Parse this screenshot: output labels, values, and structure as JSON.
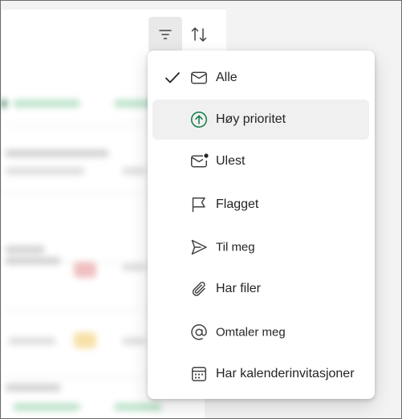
{
  "toolbar": {
    "filter_icon": "filter-icon",
    "sort_icon": "sort-arrows-icon"
  },
  "filter_menu": {
    "selected": "Alle",
    "items": [
      {
        "label": "Alle",
        "icon": "mail-icon",
        "checked": true
      },
      {
        "label": "Høy prioritet",
        "icon": "arrow-up-circle-icon",
        "hovered": true
      },
      {
        "label": "Ulest",
        "icon": "mail-unread-icon"
      },
      {
        "label": "Flagget",
        "icon": "flag-icon"
      },
      {
        "label": "Til meg",
        "icon": "send-icon"
      },
      {
        "label": "Har filer",
        "icon": "attach-icon"
      },
      {
        "label": "Omtaler meg",
        "icon": "mention-icon"
      },
      {
        "label": "Har kalenderinvitasjoner",
        "icon": "calendar-icon"
      }
    ]
  },
  "colors": {
    "accent_green": "#107c41",
    "hover_bg": "#f0f0f0",
    "text": "#242424"
  }
}
